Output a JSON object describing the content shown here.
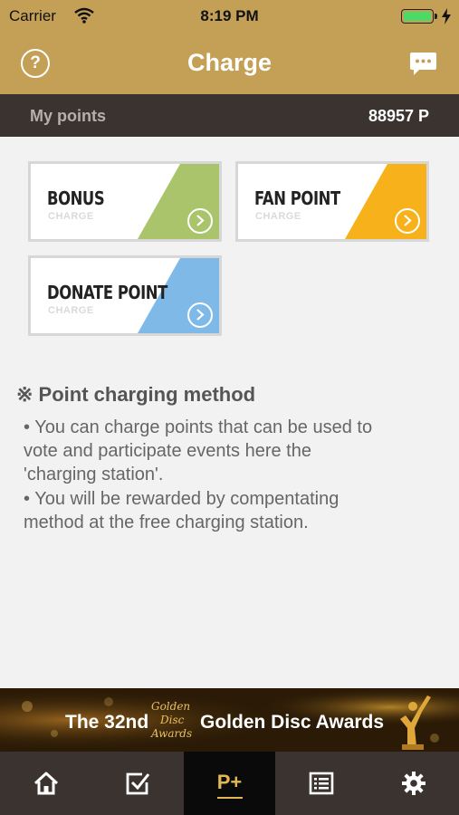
{
  "status": {
    "carrier": "Carrier",
    "time": "8:19 PM",
    "battery_level": 1.0
  },
  "header": {
    "title": "Charge",
    "help_icon": "help-circle-icon",
    "chat_icon": "chat-bubble-icon"
  },
  "points": {
    "label": "My points",
    "value": "88957 P"
  },
  "cards": [
    {
      "title": "BONUS",
      "sub": "CHARGE",
      "color": "#a9c46a"
    },
    {
      "title": "FAN POINT",
      "sub": "CHARGE",
      "color": "#f7b21b"
    },
    {
      "title": "DONATE POINT",
      "sub": "CHARGE",
      "color": "#7fb9e8"
    }
  ],
  "info": {
    "title": "※ Point charging method",
    "lines": [
      "• You can charge points that can be used to",
      "vote and participate events here the",
      "'charging station'.",
      "• You will be rewarded by compentating",
      "method at the free charging station."
    ]
  },
  "banner": {
    "prefix": "The 32nd",
    "logo_lines": [
      "Golden",
      "Disc",
      "Awards"
    ],
    "suffix": "Golden Disc Awards"
  },
  "tabs": [
    {
      "name": "home",
      "icon": "home-icon"
    },
    {
      "name": "vote",
      "icon": "check-square-icon"
    },
    {
      "name": "charge",
      "label": "P+",
      "active": true
    },
    {
      "name": "list",
      "icon": "list-icon"
    },
    {
      "name": "settings",
      "icon": "gear-icon"
    }
  ]
}
